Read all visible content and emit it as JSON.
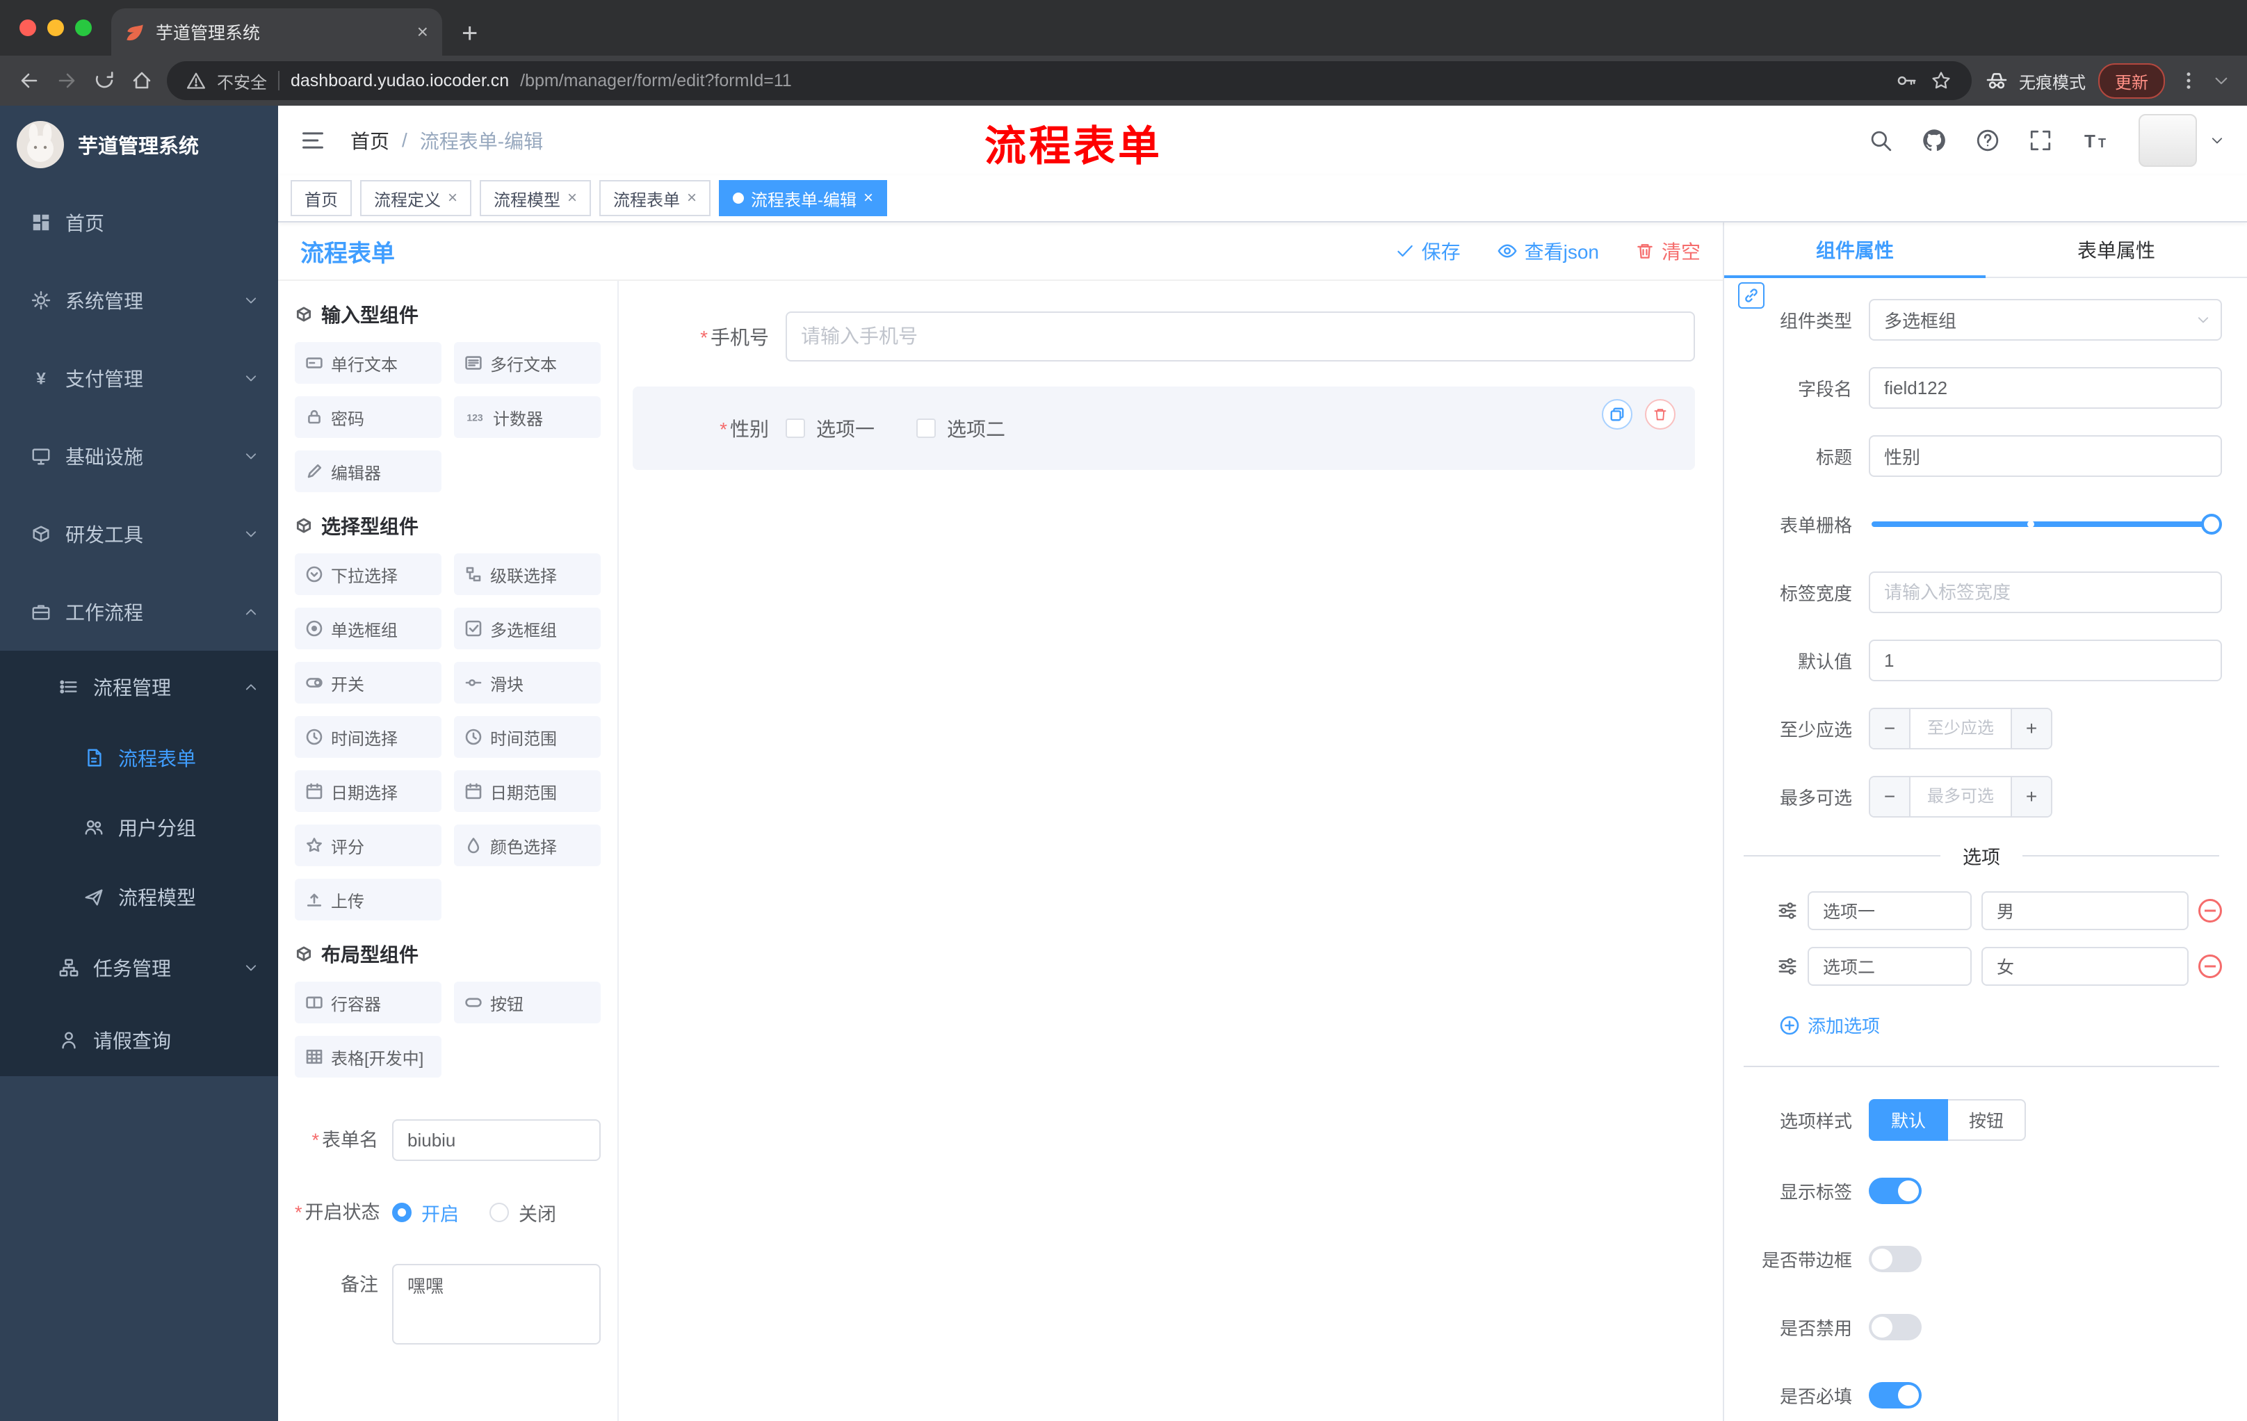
{
  "glyphs": {
    "close": "×",
    "new_tab": "+",
    "required": "*"
  },
  "browser": {
    "tab_title": "芋道管理系统",
    "security_label": "不安全",
    "url_host": "dashboard.yudao.iocoder.cn",
    "url_path": "/bpm/manager/form/edit?formId=11",
    "incognito_label": "无痕模式",
    "update_label": "更新"
  },
  "sidebar": {
    "logo_text": "芋道管理系统",
    "menu": [
      {
        "label": "首页"
      },
      {
        "label": "系统管理"
      },
      {
        "label": "支付管理"
      },
      {
        "label": "基础设施"
      },
      {
        "label": "研发工具"
      },
      {
        "label": "工作流程"
      },
      {
        "label": "流程管理"
      },
      {
        "label": "流程表单"
      },
      {
        "label": "用户分组"
      },
      {
        "label": "流程模型"
      },
      {
        "label": "任务管理"
      },
      {
        "label": "请假查询"
      }
    ]
  },
  "navbar": {
    "breadcrumb": {
      "home": "首页",
      "separator": "/",
      "current": "流程表单-编辑"
    },
    "annotation": "流程表单"
  },
  "tags": [
    {
      "label": "首页"
    },
    {
      "label": "流程定义"
    },
    {
      "label": "流程模型"
    },
    {
      "label": "流程表单"
    },
    {
      "label": "流程表单-编辑"
    }
  ],
  "editor": {
    "title": "流程表单",
    "actions": {
      "save": "保存",
      "view_json": "查看json",
      "clear": "清空"
    },
    "palette": {
      "sections": [
        {
          "title": "输入型组件",
          "items": [
            "单行文本",
            "多行文本",
            "密码",
            "计数器",
            "编辑器"
          ]
        },
        {
          "title": "选择型组件",
          "items": [
            "下拉选择",
            "级联选择",
            "单选框组",
            "多选框组",
            "开关",
            "滑块",
            "时间选择",
            "时间范围",
            "日期选择",
            "日期范围",
            "评分",
            "颜色选择",
            "上传"
          ]
        },
        {
          "title": "布局型组件",
          "items": [
            "行容器",
            "按钮",
            "表格[开发中]"
          ]
        }
      ]
    },
    "form_settings": {
      "form_name": {
        "label": "表单名",
        "value": "biubiu"
      },
      "status": {
        "label": "开启状态",
        "on": "开启",
        "off": "关闭"
      },
      "remark": {
        "label": "备注",
        "value": "嘿嘿"
      }
    },
    "canvas": {
      "phone": {
        "label": "手机号",
        "placeholder": "请输入手机号"
      },
      "gender": {
        "label": "性别",
        "option1": "选项一",
        "option2": "选项二"
      }
    }
  },
  "props": {
    "tab_component": "组件属性",
    "tab_form": "表单属性",
    "component_type": {
      "label": "组件类型",
      "value": "多选框组"
    },
    "field_name": {
      "label": "字段名",
      "value": "field122"
    },
    "title": {
      "label": "标题",
      "value": "性别"
    },
    "grid": {
      "label": "表单栅格"
    },
    "label_width": {
      "label": "标签宽度",
      "placeholder": "请输入标签宽度"
    },
    "default_value": {
      "label": "默认值",
      "value": "1"
    },
    "min_select": {
      "label": "至少应选",
      "placeholder": "至少应选",
      "minus": "−",
      "plus": "+"
    },
    "max_select": {
      "label": "最多可选",
      "placeholder": "最多可选",
      "minus": "−",
      "plus": "+"
    },
    "options_title": "选项",
    "options": [
      {
        "name": "选项一",
        "value": "男"
      },
      {
        "name": "选项二",
        "value": "女"
      }
    ],
    "add_option": "添加选项",
    "option_style": {
      "label": "选项样式",
      "options": [
        "默认",
        "按钮"
      ]
    },
    "switches": [
      {
        "label": "显示标签",
        "on": true
      },
      {
        "label": "是否带边框",
        "on": false
      },
      {
        "label": "是否禁用",
        "on": false
      },
      {
        "label": "是否必填",
        "on": true
      }
    ]
  }
}
